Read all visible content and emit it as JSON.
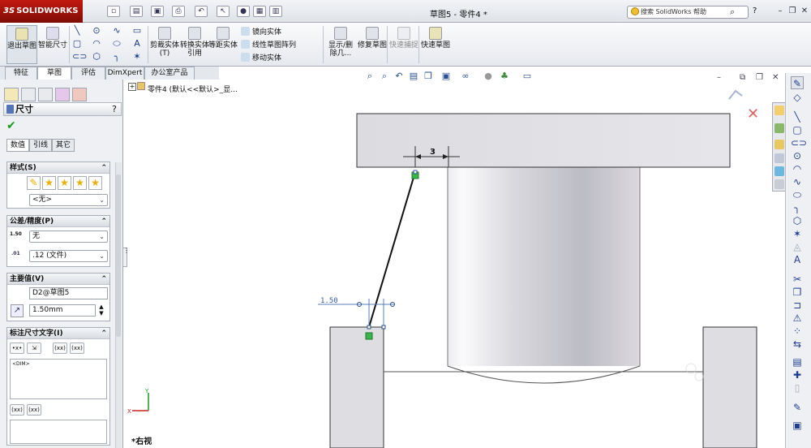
{
  "app": {
    "logo_prefix": "3S",
    "logo": "SOLIDWORKS",
    "doc_title": "草图5 - 零件4 *",
    "search_placeholder": "搜索 SolidWorks 帮助",
    "help": "?"
  },
  "ribbon": {
    "exit_sketch": "退出草图",
    "smart_dim": "智能尺寸",
    "trim": "剪裁实体(T)",
    "convert": "转换实体引用",
    "offset": "等距实体",
    "mirror": "镜向实体",
    "linear_pattern": "线性草图阵列",
    "move": "移动实体",
    "display_delete": "显示/删除几...",
    "repair": "修复草图",
    "quick_snap": "快速捕捉",
    "rapid_sketch": "快速草图"
  },
  "tabs": [
    "特征",
    "草图",
    "评估",
    "DimXpert",
    "办公室产品"
  ],
  "pm": {
    "title": "尺寸",
    "help": "?",
    "subtabs": [
      "数值",
      "引线",
      "其它"
    ],
    "style": {
      "title": "样式(S)",
      "value": "<无>"
    },
    "tolerance": {
      "title": "公差/精度(P)",
      "type_value": "无",
      "precision_value": ".12 (文件)",
      "tol_icon": "1.50",
      "prec_icon": ".01"
    },
    "primary": {
      "title": "主要值(V)",
      "name_value": "D2@草图5",
      "dim_value": "1.50mm"
    },
    "dimtext": {
      "title": "标注尺寸文字(I)",
      "dim_token": "<DIM>",
      "btn_xx": "(xx)",
      "btn_xx2": "(xx)"
    }
  },
  "featuretree": {
    "root": "零件4 (默认<<默认>_显..."
  },
  "canvas": {
    "dim_top": "3",
    "dim_left": "1.50",
    "view_name": "*右视",
    "axis_x": "X",
    "axis_y": "Y"
  }
}
